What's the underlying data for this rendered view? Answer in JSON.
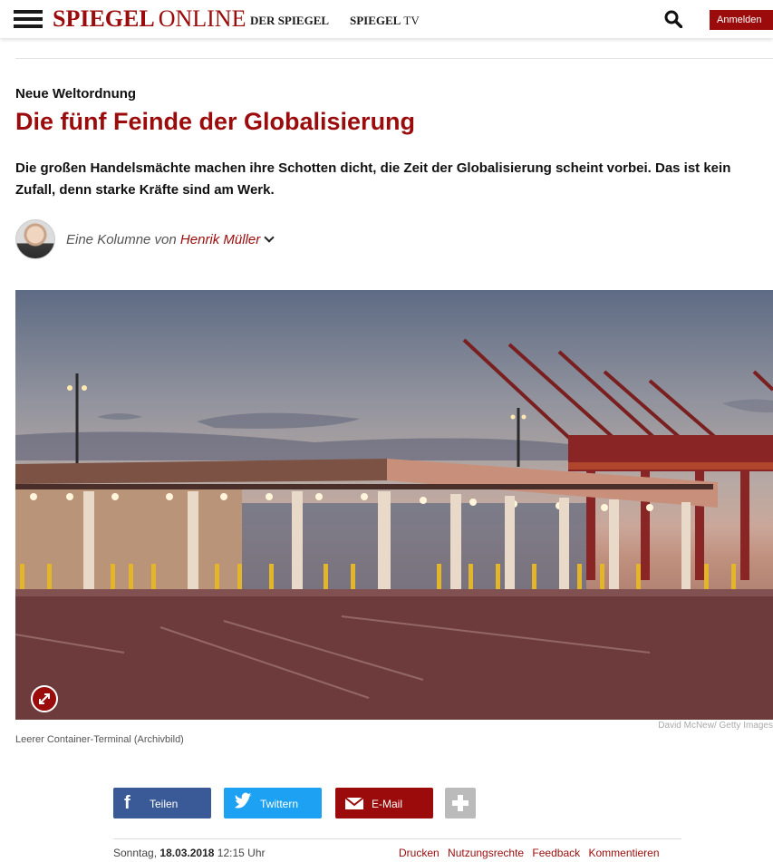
{
  "header": {
    "logo_bold": "SPIEGEL",
    "logo_light": "ONLINE",
    "nav_der_spiegel": "DER SPIEGEL",
    "nav_tv_bold": "SPIEGEL",
    "nav_tv_light": "TV",
    "login_label": "Anmelden",
    "icons": {
      "menu": "hamburger-menu-icon",
      "search": "search-icon"
    }
  },
  "article": {
    "kicker": "Neue Weltordnung",
    "headline": "Die fünf Feinde der Globalisierung",
    "intro": "Die großen Handelsmächte machen ihre Schotten dicht, die Zeit der Globalisierung scheint vorbei. Das ist kein Zufall, denn starke Kräfte sind am Werk.",
    "author_prefix": "Eine Kolumne von",
    "author_name": "Henrik Müller"
  },
  "image": {
    "caption": "Leerer Container-Terminal (Archivbild)",
    "credit": "David McNew/ Getty Images"
  },
  "share": {
    "facebook": "Teilen",
    "twitter": "Twittern",
    "email": "E-Mail"
  },
  "meta": {
    "day": "Sonntag,",
    "date": "18.03.2018",
    "time": "12:15 Uhr",
    "links": [
      "Drucken",
      "Nutzungsrechte",
      "Feedback",
      "Kommentieren"
    ]
  },
  "colors": {
    "brand_red": "#9b0b0b",
    "facebook": "#3a5a97",
    "twitter": "#1da1f2"
  }
}
